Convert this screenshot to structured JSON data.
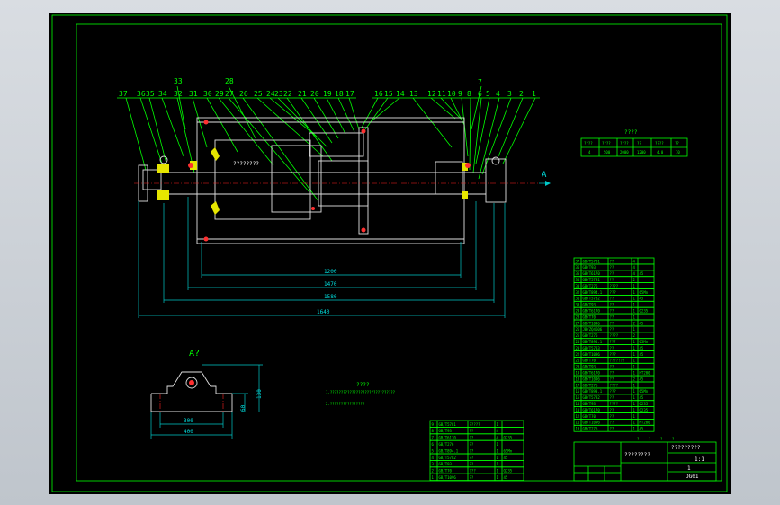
{
  "drawing": {
    "part_numbers_left": [
      "37",
      "36",
      "35",
      "34",
      "33",
      "32",
      "31",
      "30",
      "29",
      "28",
      "27",
      "26",
      "25",
      "24",
      "23",
      "22",
      "21",
      "20",
      "19",
      "18",
      "17"
    ],
    "part_numbers_right": [
      "16",
      "15",
      "14",
      "13",
      "12",
      "11",
      "10",
      "9",
      "8",
      "7",
      "6",
      "5",
      "4",
      "3",
      "2",
      "1"
    ],
    "section_label": "A",
    "motor_label": "????????",
    "dims": {
      "d1": "1200",
      "d2": "1470",
      "d3": "1580",
      "d4": "1640"
    },
    "view_label": "A?",
    "view_dims": {
      "w_inner": "300",
      "w_outer": "400",
      "h1": "130",
      "h2": "60"
    }
  },
  "spec_table": {
    "title": "????",
    "headers": [
      "????",
      "????",
      "????",
      "??",
      "????",
      "??"
    ],
    "values": [
      "4",
      "500",
      "2000",
      "1200",
      "4.0",
      "70"
    ]
  },
  "notes": {
    "title": "????",
    "line1": "1.??????????????????????????????",
    "line2": "2.????????????????"
  },
  "parts_list": {
    "rows": [
      [
        "37",
        "GB/T5781",
        "??",
        "4",
        ""
      ],
      [
        "36",
        "GB/T93",
        "??",
        "4",
        ""
      ],
      [
        "35",
        "GB/T6170",
        "??",
        "4",
        "45"
      ],
      [
        "34",
        "GB/T5781",
        "??",
        "2",
        ""
      ],
      [
        "33",
        "GB/T276",
        "????",
        "1",
        ""
      ],
      [
        "32",
        "GB/T894.1",
        "???",
        "1",
        "65Mn"
      ],
      [
        "31",
        "GB/T5782",
        "??",
        "1",
        "45"
      ],
      [
        "30",
        "GB/T93",
        "??",
        "1",
        ""
      ],
      [
        "29",
        "GB/T6170",
        "??",
        "1",
        "Q235"
      ],
      [
        "28",
        "GB/T70",
        "??",
        "1",
        ""
      ],
      [
        "27",
        "GB/T1096",
        "??",
        "2",
        "45"
      ],
      [
        "26",
        "JB/ZQ4606",
        "??",
        "1",
        ""
      ],
      [
        "25",
        "GB/T276",
        "????",
        "2",
        ""
      ],
      [
        "24",
        "GB/T894.1",
        "???",
        "1",
        "65Mn"
      ],
      [
        "23",
        "GB/T5783",
        "??",
        "1",
        "45"
      ],
      [
        "22",
        "GB/T1096",
        "???",
        "1",
        "45"
      ],
      [
        "21",
        "GB/T70",
        "???????",
        "1",
        ""
      ],
      [
        "20",
        "GB/T93",
        "??",
        "1",
        ""
      ],
      [
        "19",
        "GB/T6170",
        "??",
        "1",
        "HT200"
      ],
      [
        "18",
        "GB/T1096",
        "??",
        "2",
        "45"
      ],
      [
        "17",
        "GB/T276",
        "????",
        "1",
        ""
      ],
      [
        "16",
        "GB/T893.1",
        "???",
        "1",
        "65Mn"
      ],
      [
        "15",
        "GB/T5782",
        "??",
        "1",
        "45"
      ],
      [
        "14",
        "GB/T93",
        "????",
        "1",
        "Q235"
      ],
      [
        "13",
        "GB/T6170",
        "??",
        "1",
        "Q235"
      ],
      [
        "12",
        "GB/T70",
        "??",
        "1",
        ""
      ],
      [
        "11",
        "GB/T1096",
        "??",
        "1",
        "HT200"
      ],
      [
        "10",
        "GB/T276",
        "??",
        "1",
        "45"
      ]
    ],
    "bottom_rows": [
      [
        "9",
        "GB/T5781",
        "?????",
        "1",
        ""
      ],
      [
        "8",
        "GB/T93",
        "??",
        "4",
        ""
      ],
      [
        "7",
        "GB/T6170",
        "??",
        "4",
        "Q235"
      ],
      [
        "6",
        "GB/T276",
        "??",
        "1",
        ""
      ],
      [
        "5",
        "GB/T894.1",
        "??",
        "1",
        "65Mn"
      ],
      [
        "4",
        "GB/T5782",
        "??",
        "1",
        "45"
      ],
      [
        "3",
        "GB/T93",
        "??",
        "1",
        ""
      ],
      [
        "2",
        "GB/T70",
        "???",
        "1",
        "Q235"
      ],
      [
        "1",
        "GB/T1096",
        "??",
        "1",
        "45"
      ]
    ]
  },
  "title_block": {
    "drawing_title": "????????",
    "company": "?????????",
    "scale": "1:1",
    "sheet": "1",
    "code": "DG01",
    "marks": [
      "?",
      "?",
      "?",
      "?"
    ]
  },
  "colors": {
    "frame": "#00ff00",
    "dim": "#00c8c8",
    "outline": "#e0e0e0",
    "center": "#ff2020",
    "bearing": "#e6e600"
  }
}
